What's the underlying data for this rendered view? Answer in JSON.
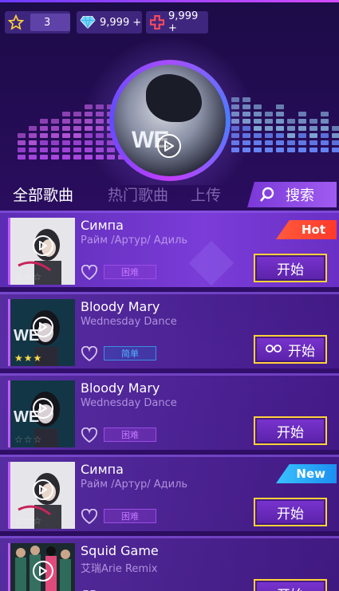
{
  "header": {
    "level": "3",
    "gems": "9,999 +",
    "hearts": "9,999 +"
  },
  "hero": {
    "disc_text": "WE"
  },
  "tabs": {
    "all": "全部歌曲",
    "hot": "热门歌曲",
    "upload": "上传",
    "search": "搜索"
  },
  "songs": [
    {
      "title": "Симпа",
      "artist": "Райм /Артур/ Адиль",
      "difficulty": "困难",
      "difficulty_type": "hard",
      "stars": 0,
      "badge": "Hot",
      "start": "开始",
      "cover": "girl",
      "has_glasses": false
    },
    {
      "title": "Bloody Mary",
      "artist": "Wednesday Dance",
      "difficulty": "简单",
      "difficulty_type": "easy",
      "stars": 3,
      "badge": "",
      "start": "开始",
      "cover": "wed",
      "has_glasses": true
    },
    {
      "title": "Bloody Mary",
      "artist": "Wednesday Dance",
      "difficulty": "困难",
      "difficulty_type": "hard",
      "stars": 0,
      "badge": "",
      "start": "开始",
      "cover": "wed",
      "has_glasses": false
    },
    {
      "title": "Симпа",
      "artist": "Райм /Артур/ Адиль",
      "difficulty": "困难",
      "difficulty_type": "hard",
      "stars": 0,
      "badge": "New",
      "start": "开始",
      "cover": "girl",
      "has_glasses": false
    },
    {
      "title": "Squid Game",
      "artist": "艾瑞Arie Remix",
      "difficulty": "",
      "difficulty_type": "",
      "stars": 0,
      "badge": "",
      "start": "开始",
      "cover": "squid",
      "has_glasses": false
    }
  ],
  "colors": {
    "accent": "#a64dff",
    "start_border": "#ffd23a",
    "hot": "#ff3a2a",
    "new": "#1c8ff0"
  }
}
